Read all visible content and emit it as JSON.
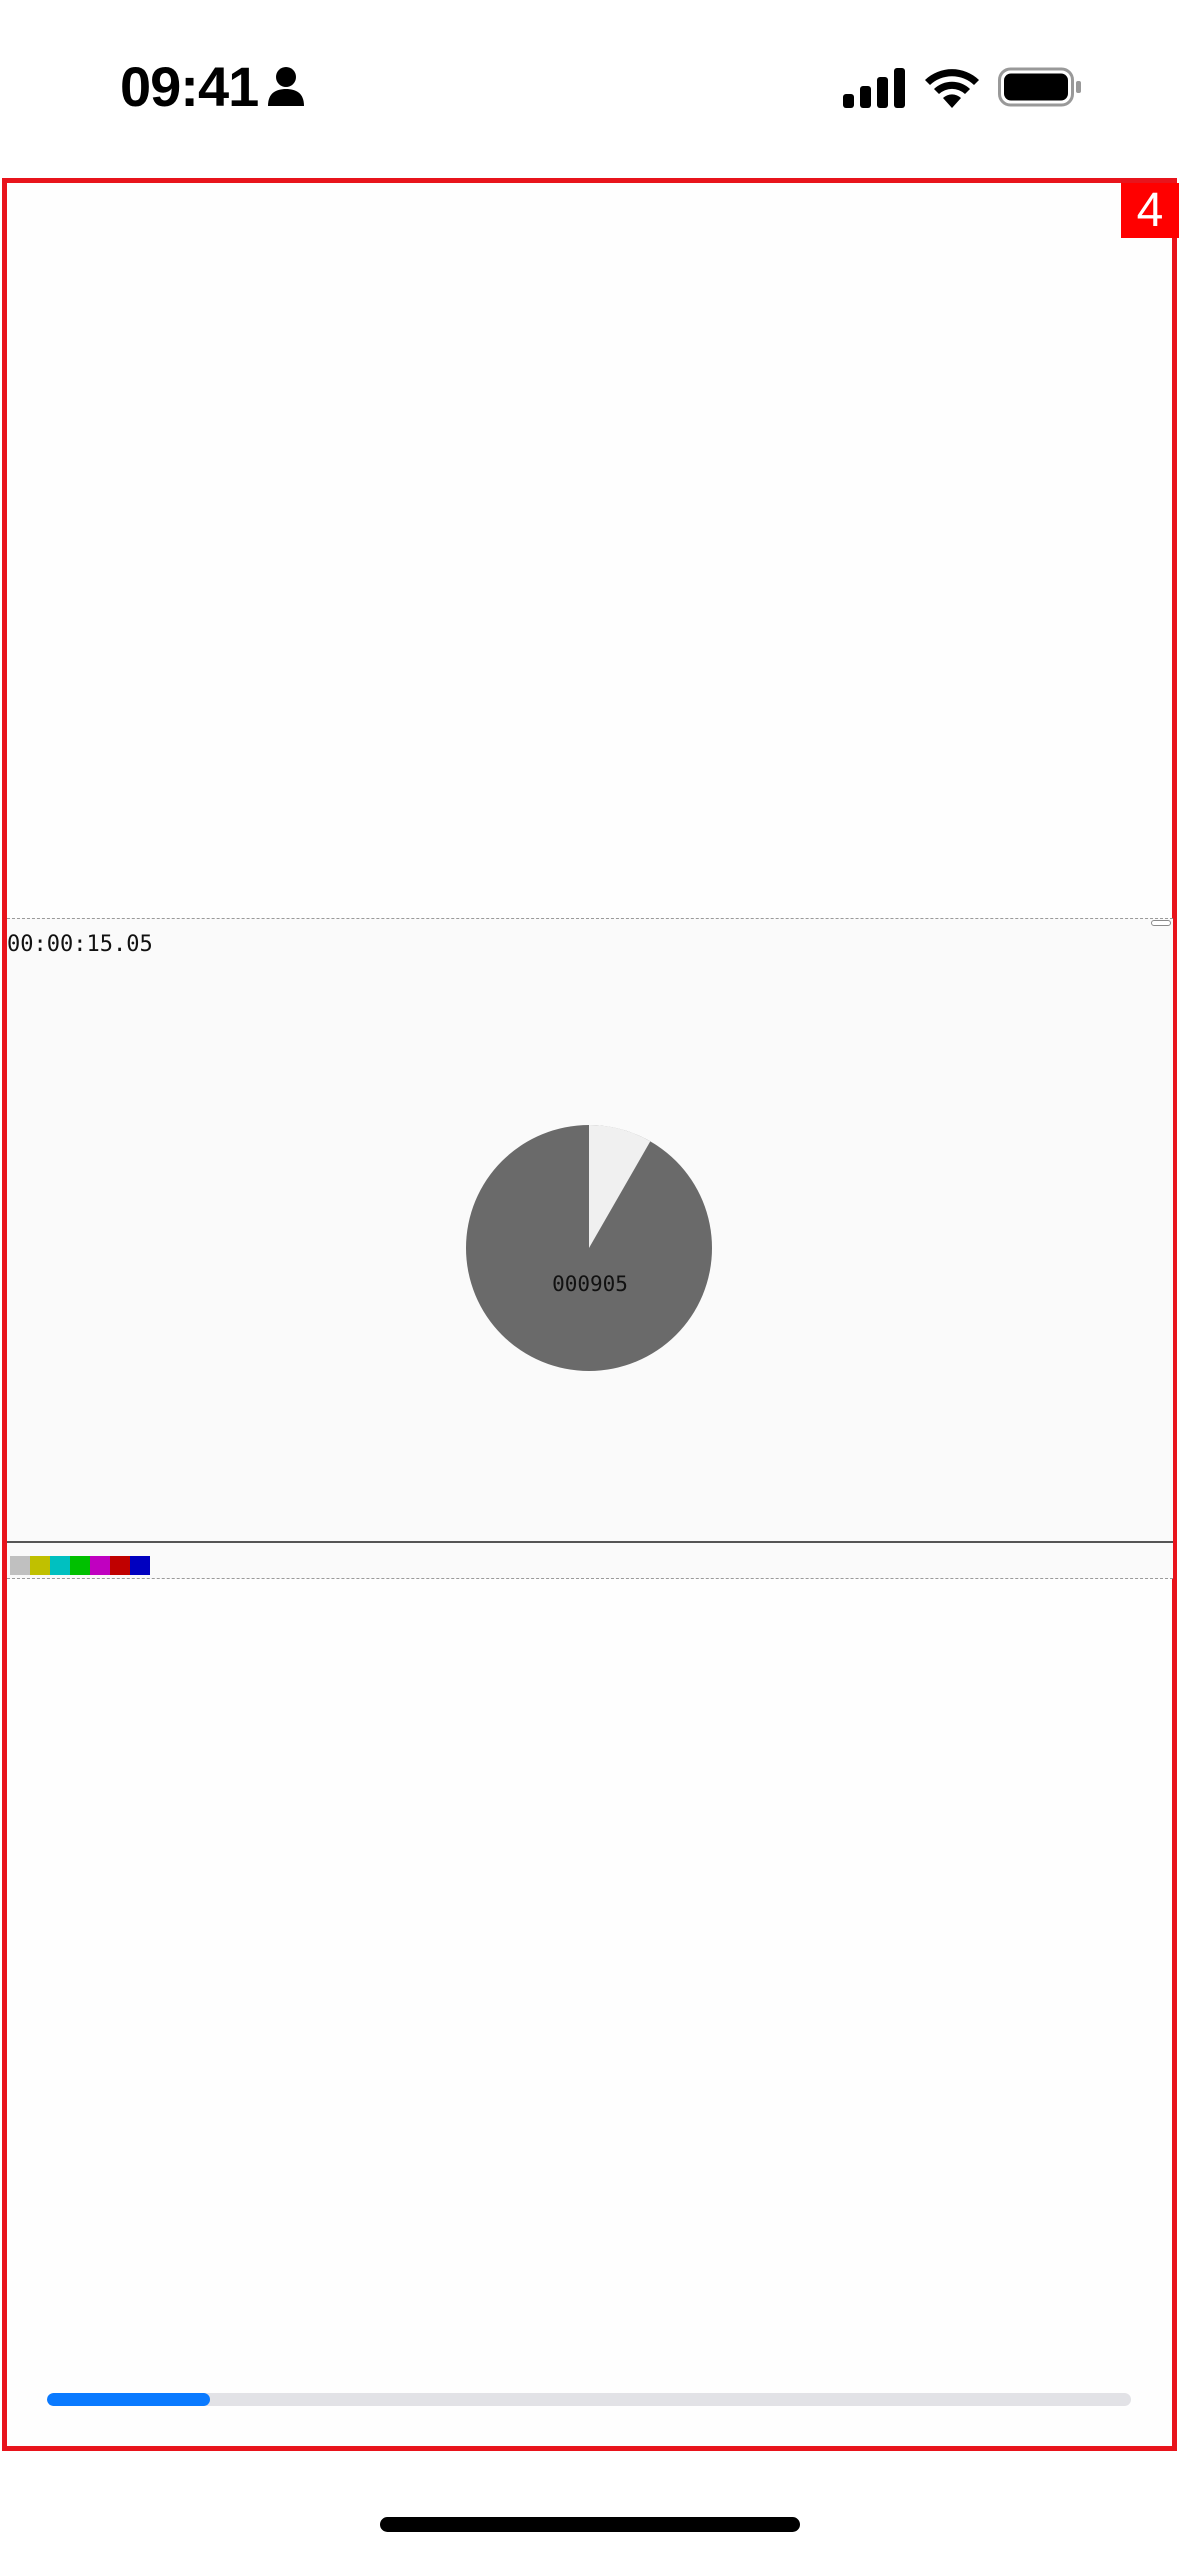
{
  "status_bar": {
    "time": "09:41",
    "icons": [
      "person-icon",
      "cellular-signal-icon",
      "wifi-icon",
      "battery-icon"
    ]
  },
  "frame": {
    "badge": "4",
    "border_color": "#e8141c"
  },
  "player": {
    "timecode": "00:00:15.05",
    "frame_counter": "000905",
    "countdown_fraction_remaining": 0.917,
    "pie_colors": {
      "remaining": "#6a6a6a",
      "elapsed": "#f0f0f0"
    },
    "color_bars": [
      "#c0c0c0",
      "#c0c000",
      "#00c0c0",
      "#00c000",
      "#c000c0",
      "#c00000",
      "#0000c0"
    ]
  },
  "progress": {
    "fraction": 0.15,
    "color": "#0a7aff"
  }
}
